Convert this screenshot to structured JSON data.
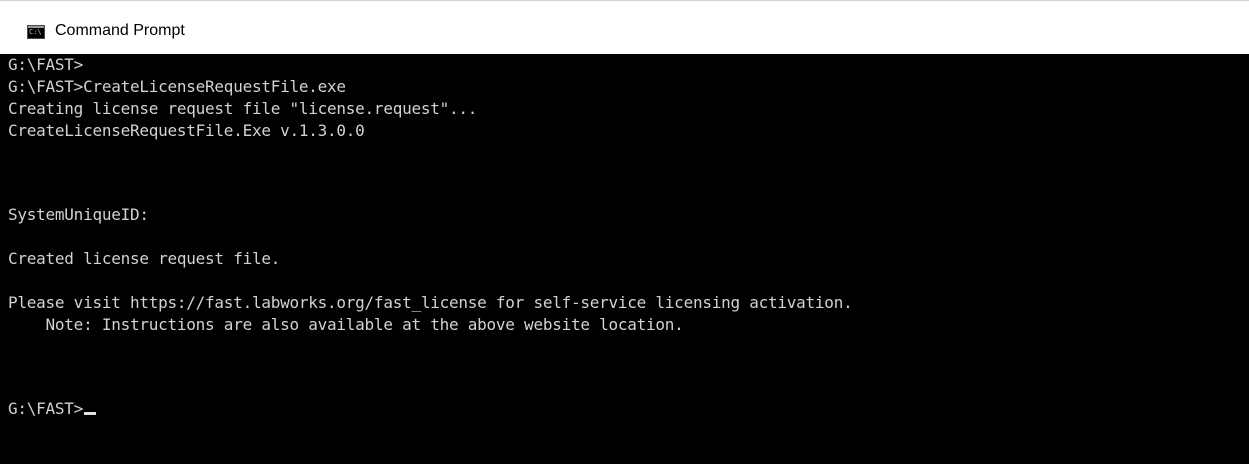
{
  "window": {
    "title": "Command Prompt",
    "icon": "cmd-icon",
    "icon_text": "C:\\"
  },
  "console": {
    "lines": [
      "G:\\FAST>",
      "G:\\FAST>CreateLicenseRequestFile.exe",
      "Creating license request file \"license.request\"...",
      "CreateLicenseRequestFile.Exe v.1.3.0.0",
      "",
      "",
      "SystemUniqueID:",
      "",
      "Created license request file.",
      "",
      "Please visit https://fast.labworks.org/fast_license for self-service licensing activation.",
      "    Note: Instructions are also available at the above website location.",
      "",
      "",
      "G:\\FAST>"
    ],
    "text_color": "#d2d2d2",
    "background_color": "#000000"
  }
}
